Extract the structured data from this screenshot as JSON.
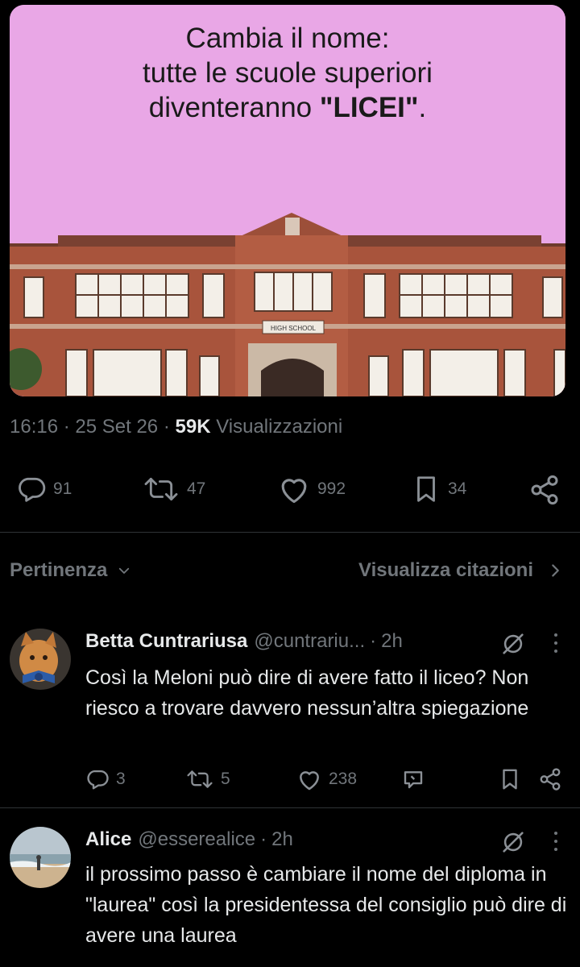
{
  "post": {
    "media": {
      "headline_line1": "Cambia il nome:",
      "headline_line2": "tutte le scuole superiori",
      "headline_line3_prefix": "diventeranno ",
      "headline_line3_bold": "\"LICEI\"",
      "headline_line3_suffix": ".",
      "building_sign": "HIGH SCHOOL",
      "background_color": "#e9a7e6"
    },
    "time": "16:16",
    "date": "25 Set 26",
    "views_count": "59K",
    "views_label": "Visualizzazioni",
    "actions": {
      "replies": "91",
      "reposts": "47",
      "likes": "992",
      "bookmarks": "34"
    }
  },
  "sort": {
    "label": "Pertinenza",
    "quotes_label": "Visualizza citazioni"
  },
  "replies": [
    {
      "name": "Betta Cuntrariusa",
      "handle": "@cuntrariu...",
      "time": "2h",
      "text": "Così la Meloni può dire di avere fatto il liceo? Non riesco a trovare davvero nessun’altra spiegazione",
      "replies": "3",
      "reposts": "5",
      "likes": "238"
    },
    {
      "name": "Alice",
      "handle": "@esserealice",
      "time": "2h",
      "text": "il prossimo passo è cambiare il nome del diploma in \"laurea\" così la presidentessa del consiglio può dire di avere una laurea"
    }
  ],
  "separator": "·",
  "colors": {
    "background": "#000000",
    "text_primary": "#e7e9ea",
    "text_secondary": "#71767b",
    "divider": "#2f3336"
  }
}
